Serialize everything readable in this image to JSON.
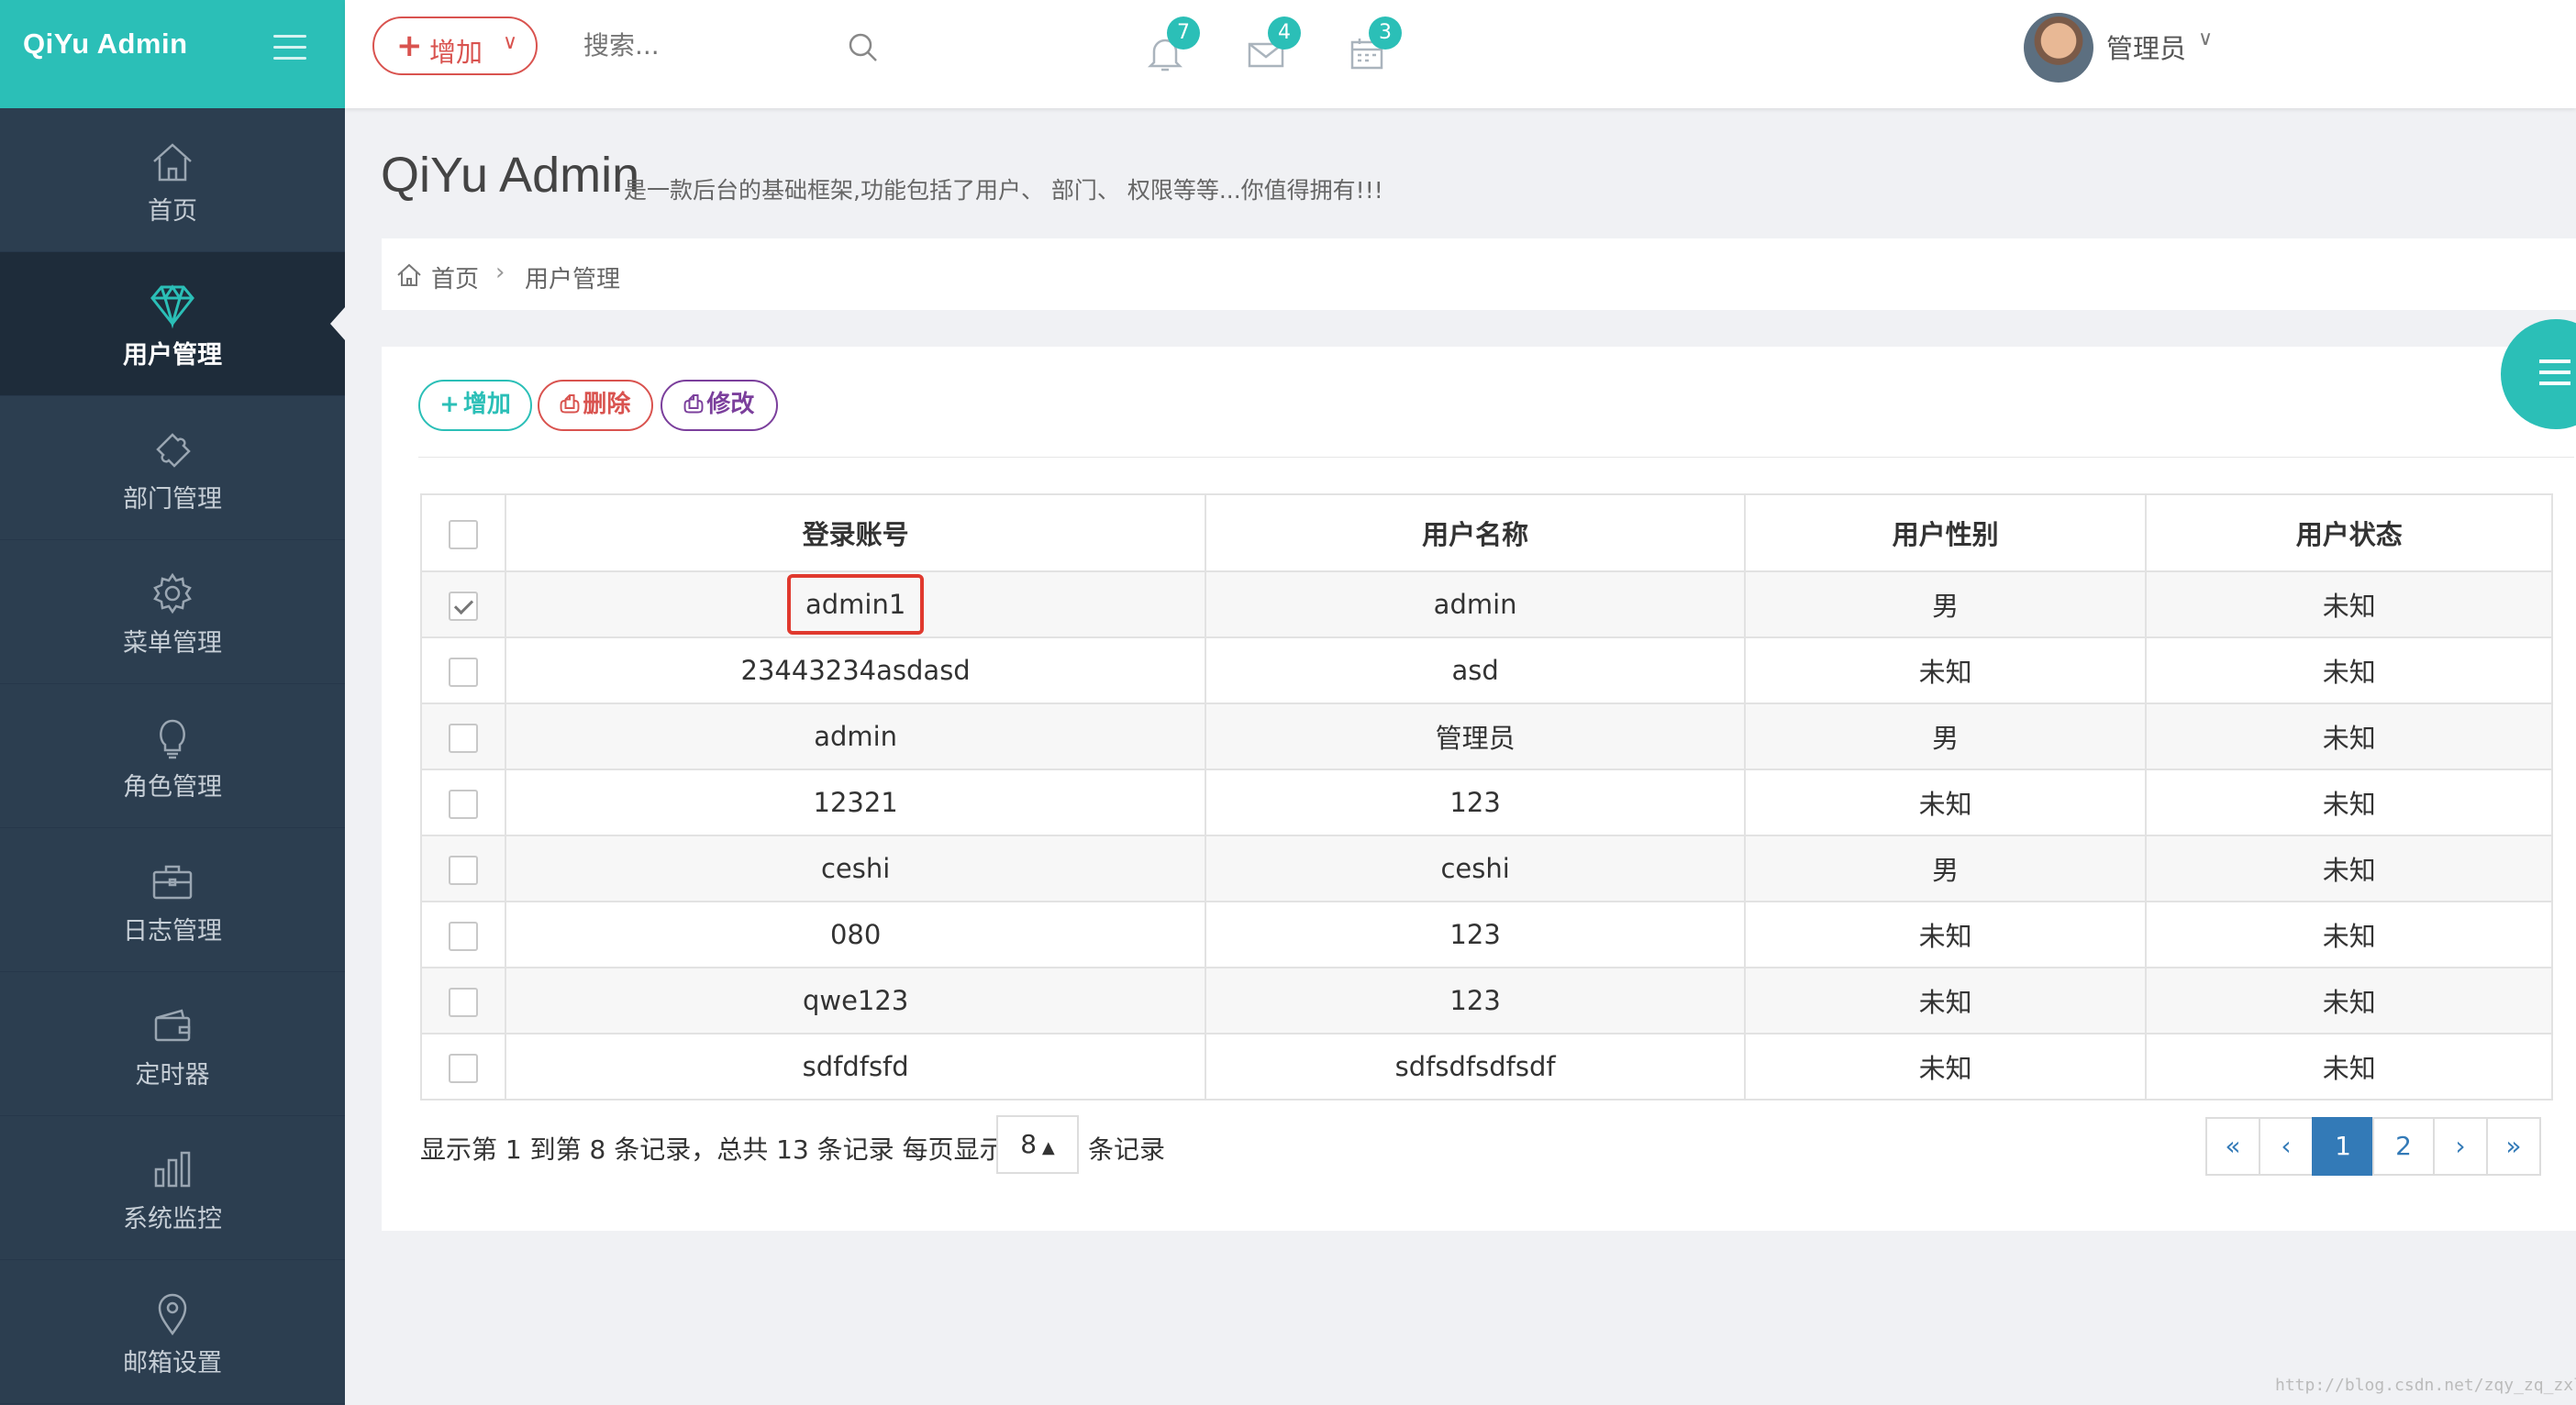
{
  "app": {
    "logo": "QiYu Admin"
  },
  "header": {
    "add_label": "增加",
    "search_placeholder": "搜索...",
    "notifications": "7",
    "messages": "4",
    "tasks": "3",
    "user_name": "管理员"
  },
  "sidebar": {
    "items": [
      {
        "label": "首页",
        "icon": "home-icon"
      },
      {
        "label": "用户管理",
        "icon": "diamond-icon",
        "active": true
      },
      {
        "label": "部门管理",
        "icon": "puzzle-icon"
      },
      {
        "label": "菜单管理",
        "icon": "gear-icon"
      },
      {
        "label": "角色管理",
        "icon": "lightbulb-icon"
      },
      {
        "label": "日志管理",
        "icon": "briefcase-icon"
      },
      {
        "label": "定时器",
        "icon": "wallet-icon"
      },
      {
        "label": "系统监控",
        "icon": "bar-chart-icon"
      },
      {
        "label": "邮箱设置",
        "icon": "map-pin-icon"
      }
    ]
  },
  "page": {
    "title": "QiYu Admin",
    "subtitle": "是一款后台的基础框架,功能包括了用户、 部门、 权限等等...你值得拥有!!!",
    "breadcrumb": [
      "首页",
      "用户管理"
    ]
  },
  "toolbar": {
    "add": "增加",
    "delete": "删除",
    "edit": "修改"
  },
  "table": {
    "columns": [
      "登录账号",
      "用户名称",
      "用户性别",
      "用户状态"
    ],
    "rows": [
      [
        "admin1",
        "admin",
        "男",
        "未知"
      ],
      [
        "23443234asdasd",
        "asd",
        "未知",
        "未知"
      ],
      [
        "admin",
        "管理员",
        "男",
        "未知"
      ],
      [
        "12321",
        "123",
        "未知",
        "未知"
      ],
      [
        "ceshi",
        "ceshi",
        "男",
        "未知"
      ],
      [
        "080",
        "123",
        "未知",
        "未知"
      ],
      [
        "qwe123",
        "123",
        "未知",
        "未知"
      ],
      [
        "sdfdfsfd",
        "sdfsdfsdfsdf",
        "未知",
        "未知"
      ]
    ]
  },
  "pagination": {
    "info": "显示第 1 到第 8 条记录，总共 13 条记录 每页显示",
    "page_size": "8",
    "suffix": "条记录",
    "first": "«",
    "prev": "‹",
    "pages": [
      "1",
      "2"
    ],
    "next": "›",
    "last": "»"
  },
  "watermark": "http://blog.csdn.net/zqy_zq_zxl"
}
